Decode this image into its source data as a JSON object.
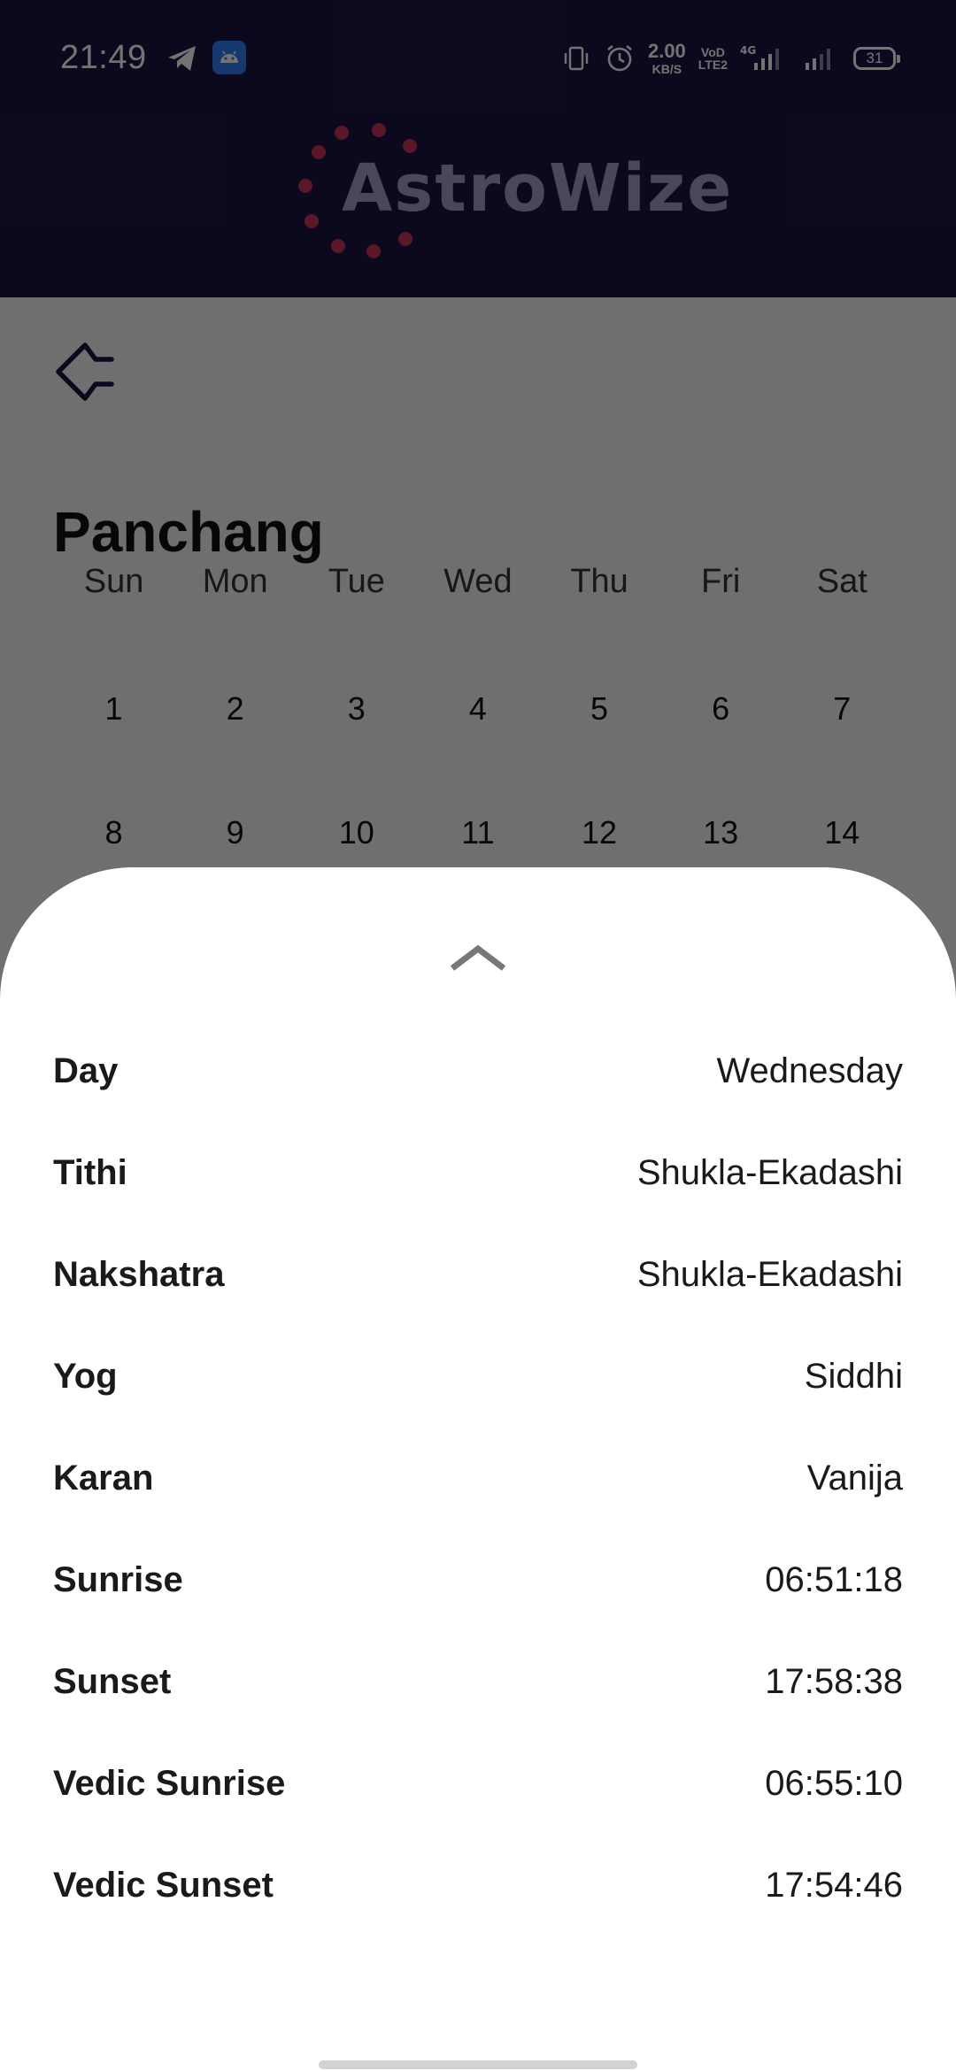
{
  "status_bar": {
    "time": "21:49",
    "net_speed_value": "2.00",
    "net_speed_unit": "KB/S",
    "volte_top": "VoD",
    "volte_bottom": "LTE2",
    "network_type": "4G",
    "battery_level": "31",
    "icons": [
      "telegram-icon",
      "android-app-icon",
      "vibrate-icon",
      "alarm-icon",
      "signal-icon",
      "battery-icon"
    ]
  },
  "header": {
    "logo_text": "AstroWize",
    "logo_dot_color": "#c8335a",
    "background_color": "#1c1343"
  },
  "page": {
    "back_icon": "back-arrow-icon",
    "title": "Panchang"
  },
  "calendar": {
    "weekdays": [
      "Sun",
      "Mon",
      "Tue",
      "Wed",
      "Thu",
      "Fri",
      "Sat"
    ],
    "weeks": [
      [
        "1",
        "2",
        "3",
        "4",
        "5",
        "6",
        "7"
      ],
      [
        "8",
        "9",
        "10",
        "11",
        "12",
        "13",
        "14"
      ]
    ]
  },
  "sheet": {
    "handle_icon": "chevron-up-icon",
    "details": [
      {
        "label": "Day",
        "value": "Wednesday"
      },
      {
        "label": "Tithi",
        "value": "Shukla-Ekadashi"
      },
      {
        "label": "Nakshatra",
        "value": "Shukla-Ekadashi"
      },
      {
        "label": "Yog",
        "value": "Siddhi"
      },
      {
        "label": "Karan",
        "value": "Vanija"
      },
      {
        "label": "Sunrise",
        "value": "06:51:18"
      },
      {
        "label": "Sunset",
        "value": "17:58:38"
      },
      {
        "label": "Vedic Sunrise",
        "value": "06:55:10"
      },
      {
        "label": "Vedic Sunset",
        "value": "17:54:46"
      }
    ]
  }
}
